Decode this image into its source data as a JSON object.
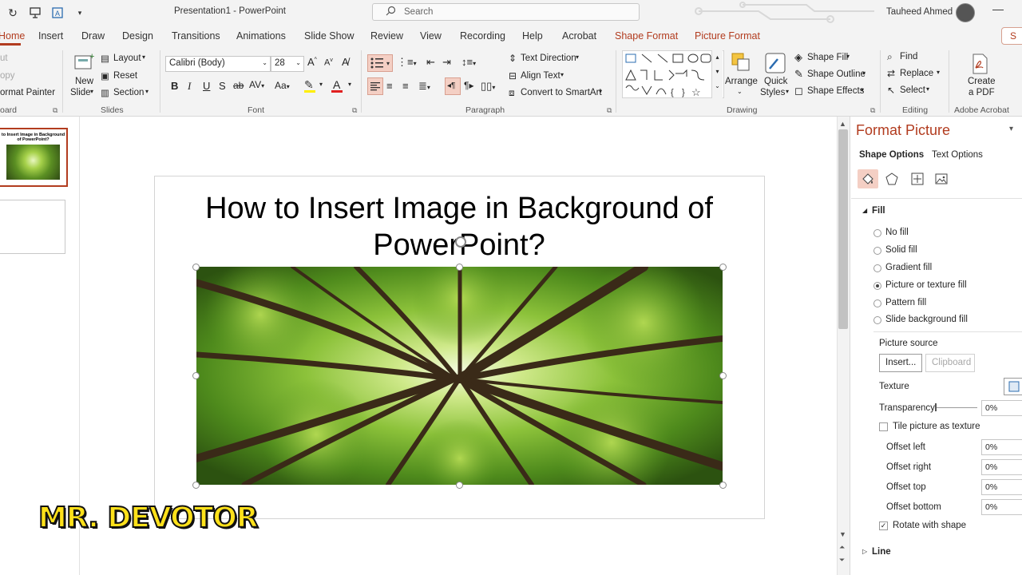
{
  "window": {
    "doc_title": "Presentation1  -  PowerPoint",
    "search_placeholder": "Search",
    "user_name": "Tauheed Ahmed"
  },
  "tabs": [
    {
      "label": "Home",
      "active": true
    },
    {
      "label": "Insert"
    },
    {
      "label": "Draw"
    },
    {
      "label": "Design"
    },
    {
      "label": "Transitions"
    },
    {
      "label": "Animations"
    },
    {
      "label": "Slide Show"
    },
    {
      "label": "Review"
    },
    {
      "label": "View"
    },
    {
      "label": "Recording"
    },
    {
      "label": "Help"
    },
    {
      "label": "Acrobat"
    },
    {
      "label": "Shape Format",
      "contextual": true
    },
    {
      "label": "Picture Format",
      "contextual": true
    }
  ],
  "share_label": "S",
  "ribbon": {
    "clipboard": {
      "cut": "ut",
      "copy": "opy",
      "format_painter": "ormat Painter",
      "label": "oard"
    },
    "slides": {
      "new_slide_1": "New",
      "new_slide_2": "Slide",
      "layout": "Layout",
      "reset": "Reset",
      "section": "Section",
      "label": "Slides"
    },
    "font": {
      "family": "Calibri (Body)",
      "size": "28",
      "label": "Font"
    },
    "paragraph": {
      "text_direction": "Text Direction",
      "align_text": "Align Text",
      "convert_smartart": "Convert to SmartArt",
      "label": "Paragraph"
    },
    "drawing": {
      "arrange": "Arrange",
      "quick_styles_1": "Quick",
      "quick_styles_2": "Styles",
      "shape_fill": "Shape Fill",
      "shape_outline": "Shape Outline",
      "shape_effects": "Shape Effects",
      "label": "Drawing"
    },
    "editing": {
      "find": "Find",
      "replace": "Replace",
      "select": "Select",
      "label": "Editing"
    },
    "acrobat": {
      "create_pdf_1": "Create",
      "create_pdf_2": "a PDF",
      "label": "Adobe Acrobat"
    }
  },
  "thumbnail": {
    "title": "to Insert Image in Background of PowerPoint?"
  },
  "slide": {
    "title_line1": "How to Insert Image in Background of",
    "title_line2": "PowerPoint?"
  },
  "watermark": "MR. DEVOTOR",
  "format_pane": {
    "title": "Format Picture",
    "tab_shape_options": "Shape Options",
    "tab_text_options": "Text Options",
    "fill_header": "Fill",
    "fill_options": [
      {
        "label": "No fill",
        "selected": false
      },
      {
        "label": "Solid fill",
        "selected": false
      },
      {
        "label": "Gradient fill",
        "selected": false
      },
      {
        "label": "Picture or texture fill",
        "selected": true
      },
      {
        "label": "Pattern fill",
        "selected": false
      },
      {
        "label": "Slide background fill",
        "selected": false
      }
    ],
    "picture_source": "Picture source",
    "insert_button": "Insert...",
    "clipboard_button": "Clipboard",
    "texture": "Texture",
    "transparency": "Transparency",
    "transparency_value": "0%",
    "tile_picture": "Tile picture as texture",
    "offset_left": "Offset left",
    "offset_left_value": "0%",
    "offset_right": "Offset right",
    "offset_right_value": "0%",
    "offset_top": "Offset top",
    "offset_top_value": "0%",
    "offset_bottom": "Offset bottom",
    "offset_bottom_value": "0%",
    "rotate_with_shape": "Rotate with shape",
    "rotate_checked": true,
    "line_header": "Line"
  }
}
